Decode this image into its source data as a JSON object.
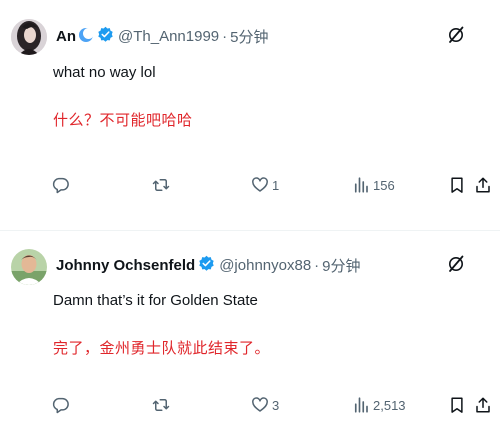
{
  "tweets": [
    {
      "display_name": "An",
      "handle": "@Th_Ann1999",
      "separator": "·",
      "time": "5分钟",
      "text_en": "what no way lol",
      "text_zh": "什么？不可能吧哈哈",
      "reply_count": "",
      "retweet_count": "",
      "like_count": "1",
      "view_count": "156",
      "icons": [
        "moon-icon",
        "verified-badge-icon",
        "grok-icon",
        "reply-icon",
        "retweet-icon",
        "like-icon",
        "views-icon",
        "bookmark-icon",
        "share-icon"
      ]
    },
    {
      "display_name": "Johnny Ochsenfeld",
      "handle": "@johnnyox88",
      "separator": "·",
      "time": "9分钟",
      "text_en": "Damn that’s it for Golden State",
      "text_zh": "完了，金州勇士队就此结束了。",
      "reply_count": "",
      "retweet_count": "",
      "like_count": "3",
      "view_count": "2,513",
      "icons": [
        "verified-badge-icon",
        "grok-icon",
        "reply-icon",
        "retweet-icon",
        "like-icon",
        "views-icon",
        "bookmark-icon",
        "share-icon"
      ]
    }
  ],
  "colors": {
    "verified": "#1d9bf0",
    "translation_text": "#e0262b",
    "secondary_text": "#536471",
    "primary_text": "#0f1419",
    "divider": "#eff3f4"
  }
}
